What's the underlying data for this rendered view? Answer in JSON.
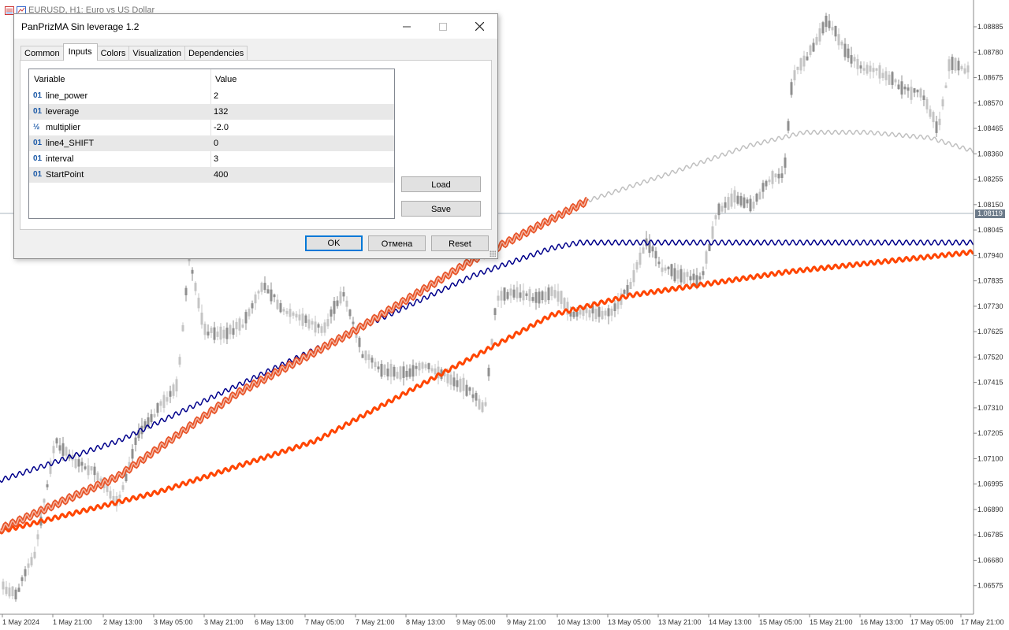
{
  "chart": {
    "title": "EURUSD, H1:  Euro vs US Dollar",
    "current_price": "1.08119",
    "price_labels": [
      "1.08885",
      "1.08780",
      "1.08675",
      "1.08570",
      "1.08465",
      "1.08360",
      "1.08255",
      "1.08150",
      "1.08045",
      "1.07940",
      "1.07835",
      "1.07730",
      "1.07625",
      "1.07520",
      "1.07415",
      "1.07310",
      "1.07205",
      "1.07100",
      "1.06995",
      "1.06890",
      "1.06785",
      "1.06680",
      "1.06575"
    ],
    "time_labels": [
      "1 May 2024",
      "1 May 21:00",
      "2 May 13:00",
      "3 May 05:00",
      "3 May 21:00",
      "6 May 13:00",
      "7 May 05:00",
      "7 May 21:00",
      "8 May 13:00",
      "9 May 05:00",
      "9 May 21:00",
      "10 May 13:00",
      "13 May 05:00",
      "13 May 21:00",
      "14 May 13:00",
      "15 May 05:00",
      "15 May 21:00",
      "16 May 13:00",
      "17 May 05:00",
      "17 May 21:00"
    ],
    "colors": {
      "ma_gray": "#c0c0c0",
      "ma_orange": "#ff4500",
      "ma_blue": "#00008b",
      "ma_band": "#e8552a",
      "candle": "#9a9a9a",
      "grid": "#aab4bf"
    }
  },
  "dialog": {
    "title": "PanPrizMA Sin leverage 1.2",
    "tabs": [
      "Common",
      "Inputs",
      "Colors",
      "Visualization",
      "Dependencies"
    ],
    "active_tab": "Inputs",
    "table": {
      "headers": {
        "variable": "Variable",
        "value": "Value"
      },
      "rows": [
        {
          "type": "01",
          "name": "line_power",
          "value": "2"
        },
        {
          "type": "½",
          "name": "leverage",
          "value": "132"
        },
        {
          "type": "½",
          "name": "multiplier",
          "value": "-2.0"
        },
        {
          "type": "01",
          "name": "line4_SHIFT",
          "value": "0"
        },
        {
          "type": "01",
          "name": "interval",
          "value": "3"
        },
        {
          "type": "01",
          "name": "StartPoint",
          "value": "400"
        }
      ]
    },
    "buttons": {
      "load": "Load",
      "save": "Save",
      "ok": "OK",
      "cancel": "Отмена",
      "reset": "Reset"
    }
  }
}
